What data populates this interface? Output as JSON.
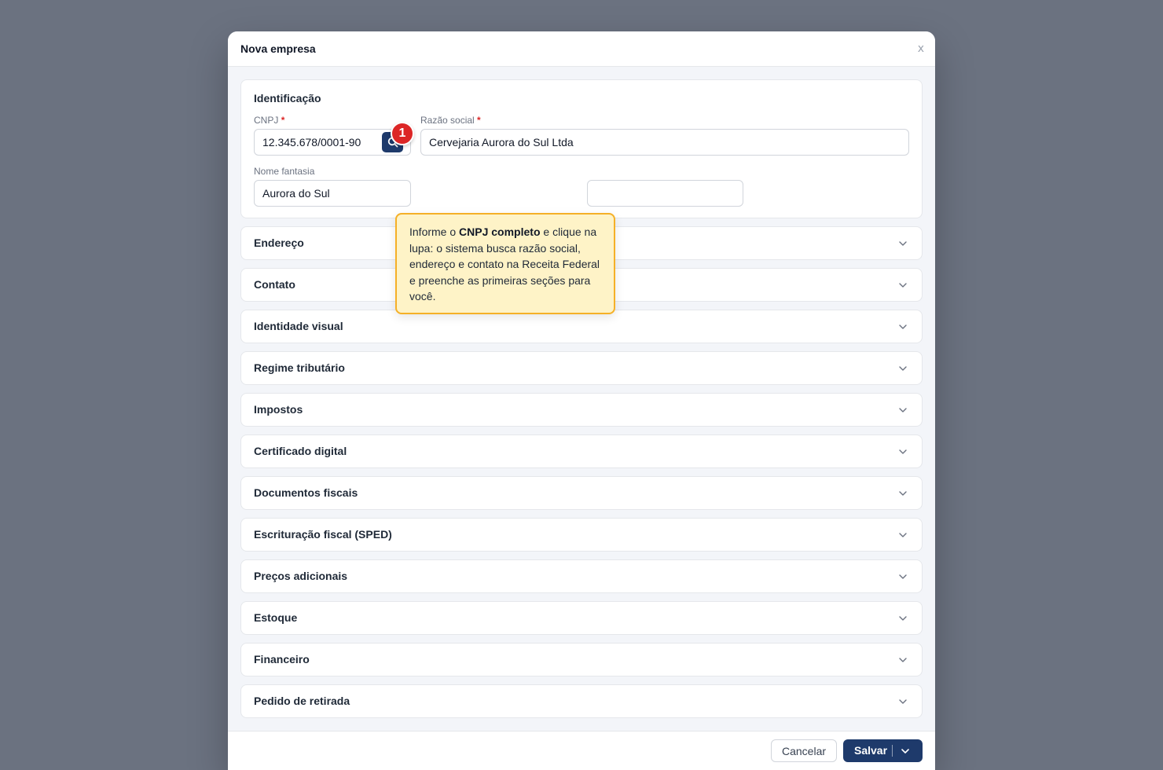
{
  "modal": {
    "title": "Nova empresa",
    "close_label": "x"
  },
  "identificacao": {
    "title": "Identificação",
    "cnpj": {
      "label": "CNPJ",
      "required": "*",
      "value": "12.345.678/0001-90"
    },
    "razao_social": {
      "label": "Razão social",
      "required": "*",
      "value": "Cervejaria Aurora do Sul Ltda"
    },
    "nome_fantasia": {
      "label": "Nome fantasia",
      "value": "Aurora do Sul"
    },
    "extra_field": {
      "value": ""
    }
  },
  "tooltip": {
    "step": "1",
    "text_before": "Informe o ",
    "text_bold": "CNPJ completo",
    "text_after": " e clique na lupa: o sistema busca razão social, endereço e contato na Receita Federal e preenche as primeiras seções para você."
  },
  "sections": [
    {
      "label": "Endereço"
    },
    {
      "label": "Contato"
    },
    {
      "label": "Identidade visual"
    },
    {
      "label": "Regime tributário"
    },
    {
      "label": "Impostos"
    },
    {
      "label": "Certificado digital"
    },
    {
      "label": "Documentos fiscais"
    },
    {
      "label": "Escrituração fiscal (SPED)"
    },
    {
      "label": "Preços adicionais"
    },
    {
      "label": "Estoque"
    },
    {
      "label": "Financeiro"
    },
    {
      "label": "Pedido de retirada"
    }
  ],
  "footer": {
    "cancel_label": "Cancelar",
    "save_label": "Salvar"
  },
  "icons": {
    "search": "search-icon",
    "chevron": "chevron-down-icon",
    "close": "close-icon"
  },
  "colors": {
    "primary": "#1e3a6b",
    "required": "#dc2626",
    "badge": "#dc2626",
    "tooltip_bg": "#fef3c7",
    "tooltip_border": "#f5b027",
    "overlay": "#6b7280"
  }
}
